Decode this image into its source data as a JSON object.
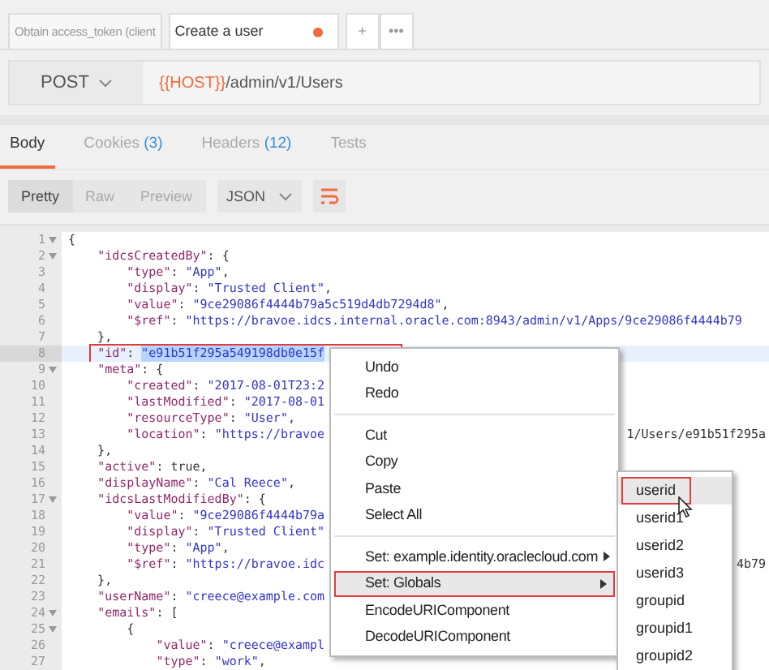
{
  "request_tabs": [
    {
      "label": "Obtain access_token (client",
      "selected": false,
      "unsaved": false
    },
    {
      "label": "Create a user",
      "selected": true,
      "unsaved": true
    }
  ],
  "tab_actions": [
    "+",
    "•••"
  ],
  "request": {
    "method": "POST",
    "url_variable": "{{HOST}}",
    "url_path": "/admin/v1/Users"
  },
  "response_tabs": [
    {
      "label": "Body",
      "selected": true
    },
    {
      "label": "Cookies",
      "count": "(3)",
      "selected": false
    },
    {
      "label": "Headers",
      "count": "(12)",
      "selected": false
    },
    {
      "label": "Tests",
      "selected": false
    }
  ],
  "view_modes": [
    {
      "label": "Pretty",
      "selected": true
    },
    {
      "label": "Raw",
      "selected": false
    },
    {
      "label": "Preview",
      "selected": false
    }
  ],
  "format": "JSON",
  "code_lines": [
    {
      "number": "1",
      "text": "{",
      "fold": true
    },
    {
      "number": "2",
      "text": "    \"idcsCreatedBy\": {",
      "fold": true
    },
    {
      "number": "3",
      "text": "        \"type\": \"App\",",
      "fold": false
    },
    {
      "number": "4",
      "text": "        \"display\": \"Trusted Client\",",
      "fold": false
    },
    {
      "number": "5",
      "text": "        \"value\": \"9ce29086f4444b79a5c519d4db7294d8\",",
      "fold": false
    },
    {
      "number": "6",
      "text": "        \"$ref\": \"https://bravoe.idcs.internal.oracle.com:8943/admin/v1/Apps/9ce29086f4444b79",
      "fold": false
    },
    {
      "number": "7",
      "text": "    },",
      "fold": false
    },
    {
      "number": "8",
      "text": "    \"id\": ",
      "selection": "\"e91b51f295a549198db0e15f",
      "fold": false,
      "selected": true,
      "outlined": true
    },
    {
      "number": "9",
      "text": "    \"meta\": {",
      "fold": true
    },
    {
      "number": "10",
      "text": "        \"created\": \"2017-08-01T23:2",
      "fold": false
    },
    {
      "number": "11",
      "text": "        \"lastModified\": \"2017-08-01",
      "fold": false
    },
    {
      "number": "12",
      "text": "        \"resourceType\": \"User\",",
      "fold": false
    },
    {
      "number": "13",
      "text": "        \"location\": \"https://bravoe",
      "tail": "1/Users/e91b51f295a",
      "fold": false
    },
    {
      "number": "14",
      "text": "    },",
      "fold": false
    },
    {
      "number": "15",
      "text": "    \"active\": true,",
      "fold": false
    },
    {
      "number": "16",
      "text": "    \"displayName\": \"Cal Reece\",",
      "fold": false
    },
    {
      "number": "17",
      "text": "    \"idcsLastModifiedBy\": {",
      "fold": true
    },
    {
      "number": "18",
      "text": "        \"value\": \"9ce29086f4444b79a",
      "fold": false
    },
    {
      "number": "19",
      "text": "        \"display\": \"Trusted Client\"",
      "fold": false
    },
    {
      "number": "20",
      "text": "        \"type\": \"App\",",
      "fold": false
    },
    {
      "number": "21",
      "text": "        \"$ref\": \"https://bravoe.idc",
      "tail": "4b79",
      "fold": false
    },
    {
      "number": "22",
      "text": "    },",
      "fold": false
    },
    {
      "number": "23",
      "text": "    \"userName\": \"creece@example.com",
      "fold": false
    },
    {
      "number": "24",
      "text": "    \"emails\": [",
      "fold": true
    },
    {
      "number": "25",
      "text": "        {",
      "fold": true
    },
    {
      "number": "26",
      "text": "            \"value\": \"creece@exampl",
      "fold": false
    },
    {
      "number": "27",
      "text": "            \"type\": \"work\",",
      "fold": false
    }
  ],
  "context_menu": [
    {
      "label": "Undo",
      "kind": "item",
      "submenu": false,
      "selected": false,
      "outlined": false
    },
    {
      "label": "Redo",
      "kind": "item",
      "submenu": false,
      "selected": false,
      "outlined": false
    },
    {
      "kind": "separator"
    },
    {
      "label": "Cut",
      "kind": "item",
      "submenu": false,
      "selected": false,
      "outlined": false
    },
    {
      "label": "Copy",
      "kind": "item",
      "submenu": false,
      "selected": false,
      "outlined": false
    },
    {
      "label": "Paste",
      "kind": "item",
      "submenu": false,
      "selected": false,
      "outlined": false
    },
    {
      "label": "Select All",
      "kind": "item",
      "submenu": false,
      "selected": false,
      "outlined": false
    },
    {
      "kind": "separator"
    },
    {
      "label": "Set: example.identity.oraclecloud.com",
      "kind": "item",
      "submenu": true,
      "selected": false,
      "outlined": false
    },
    {
      "label": "Set: Globals",
      "kind": "item",
      "submenu": true,
      "selected": true,
      "outlined": true
    },
    {
      "label": "EncodeURIComponent",
      "kind": "item",
      "submenu": false,
      "selected": false,
      "outlined": false
    },
    {
      "label": "DecodeURIComponent",
      "kind": "item",
      "submenu": false,
      "selected": false,
      "outlined": false
    }
  ],
  "globals_submenu": [
    {
      "label": "userid",
      "selected": true,
      "outlined": true
    },
    {
      "label": "userid1",
      "selected": false,
      "outlined": false
    },
    {
      "label": "userid2",
      "selected": false,
      "outlined": false
    },
    {
      "label": "userid3",
      "selected": false,
      "outlined": false
    },
    {
      "label": "groupid",
      "selected": false,
      "outlined": false
    },
    {
      "label": "groupid1",
      "selected": false,
      "outlined": false
    },
    {
      "label": "groupid2",
      "selected": false,
      "outlined": false
    }
  ]
}
